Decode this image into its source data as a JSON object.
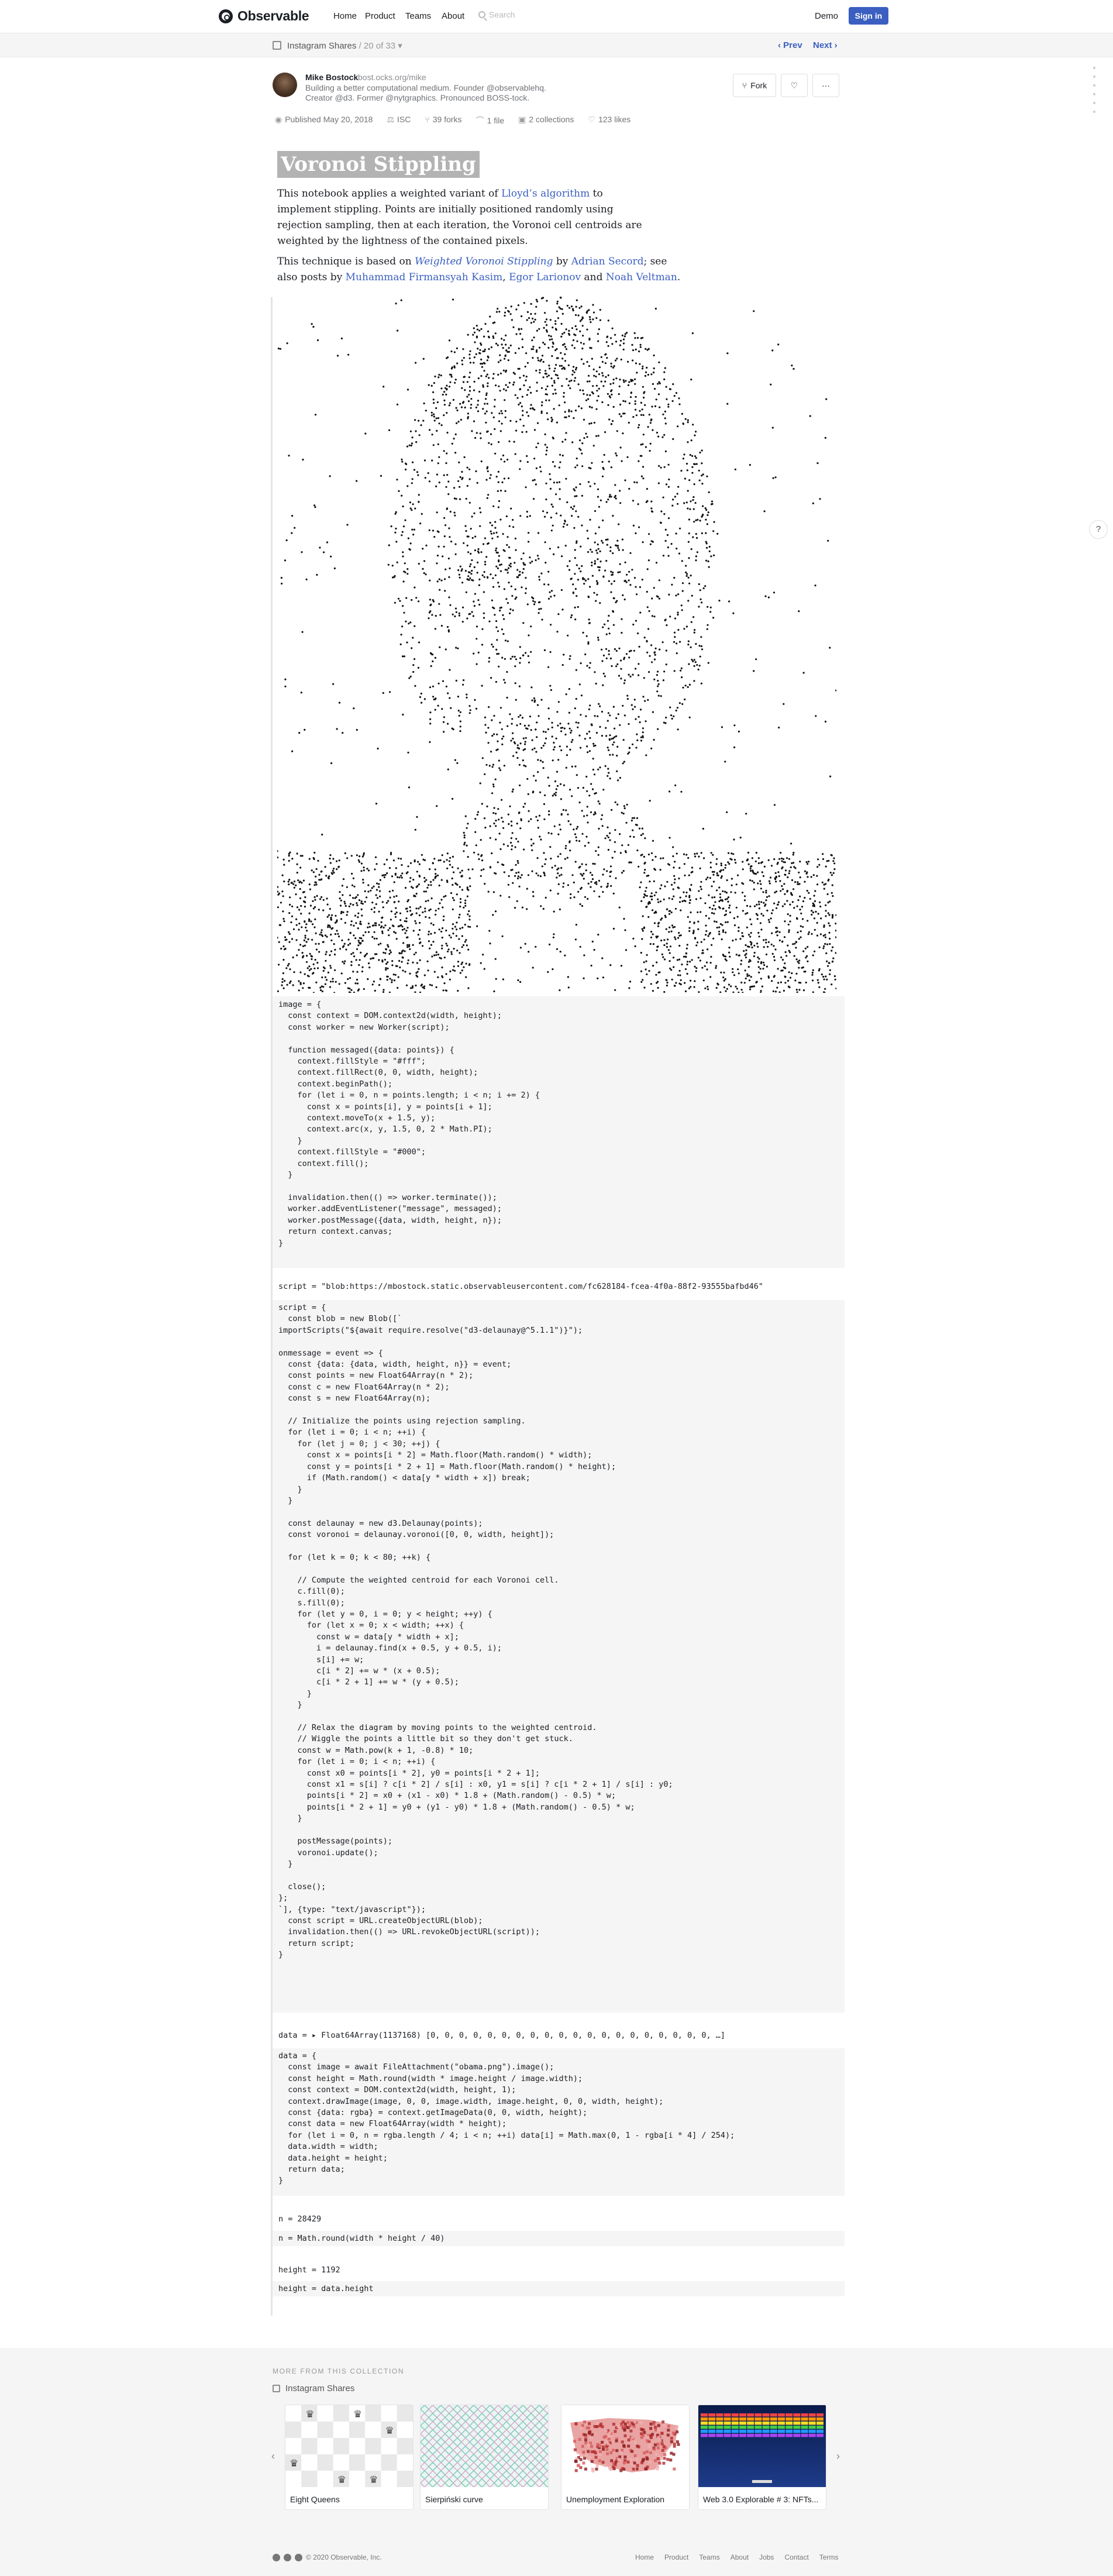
{
  "nav": {
    "brand": "Observable",
    "links": [
      "Home",
      "Product",
      "Teams",
      "About"
    ],
    "search_placeholder": "Search",
    "demo": "Demo",
    "signin": "Sign in"
  },
  "collection": {
    "name": "Instagram Shares",
    "position": "/ 20 of 33",
    "prev": "‹ Prev",
    "next": "Next ›"
  },
  "author": {
    "name": "Mike Bostock",
    "site": "bost.ocks.org/mike",
    "bio1": "Building a better computational medium. Founder @observablehq.",
    "bio2": "Creator @d3. Former @nytgraphics. Pronounced BOSS-tock."
  },
  "actions": {
    "fork": "Fork"
  },
  "meta": {
    "published": "Published May 20, 2018",
    "license": "ISC",
    "forks": "39 forks",
    "files": "1 file",
    "collections": "2 collections",
    "likes": "123 likes"
  },
  "notebook": {
    "title": "Voronoi Stippling",
    "p1_a": "This notebook applies a weighted variant of ",
    "p1_link": "Lloyd’s algorithm",
    "p1_b": " to implement stippling. Points are initially positioned randomly using rejection sampling, then at each iteration, the Voronoi cell centroids are weighted by the lightness of the contained pixels.",
    "p2_a": "This technique is based on ",
    "p2_link1": "Weighted Voronoi Stippling",
    "p2_b": " by ",
    "p2_link2": "Adrian Secord",
    "p2_c": "; see also posts by ",
    "p2_link3": "Muhammad Firmansyah Kasim",
    "p2_d": ", ",
    "p2_link4": "Egor Larionov",
    "p2_e": " and ",
    "p2_link5": "Noah Veltman",
    "p2_f": "."
  },
  "cells": {
    "image_code": "image = {\n  const context = DOM.context2d(width, height);\n  const worker = new Worker(script);\n\n  function messaged({data: points}) {\n    context.fillStyle = \"#fff\";\n    context.fillRect(0, 0, width, height);\n    context.beginPath();\n    for (let i = 0, n = points.length; i < n; i += 2) {\n      const x = points[i], y = points[i + 1];\n      context.moveTo(x + 1.5, y);\n      context.arc(x, y, 1.5, 0, 2 * Math.PI);\n    }\n    context.fillStyle = \"#000\";\n    context.fill();\n  }\n\n  invalidation.then(() => worker.terminate());\n  worker.addEventListener(\"message\", messaged);\n  worker.postMessage({data, width, height, n});\n  return context.canvas;\n}",
    "script_output": "script = \"blob:https://mbostock.static.observableusercontent.com/fc628184-fcea-4f0a-88f2-93555bafbd46\"",
    "script_code": "script = {\n  const blob = new Blob([`\nimportScripts(\"${await require.resolve(\"d3-delaunay@^5.1.1\")}\");\n\nonmessage = event => {\n  const {data: {data, width, height, n}} = event;\n  const points = new Float64Array(n * 2);\n  const c = new Float64Array(n * 2);\n  const s = new Float64Array(n);\n\n  // Initialize the points using rejection sampling.\n  for (let i = 0; i < n; ++i) {\n    for (let j = 0; j < 30; ++j) {\n      const x = points[i * 2] = Math.floor(Math.random() * width);\n      const y = points[i * 2 + 1] = Math.floor(Math.random() * height);\n      if (Math.random() < data[y * width + x]) break;\n    }\n  }\n\n  const delaunay = new d3.Delaunay(points);\n  const voronoi = delaunay.voronoi([0, 0, width, height]);\n\n  for (let k = 0; k < 80; ++k) {\n\n    // Compute the weighted centroid for each Voronoi cell.\n    c.fill(0);\n    s.fill(0);\n    for (let y = 0, i = 0; y < height; ++y) {\n      for (let x = 0; x < width; ++x) {\n        const w = data[y * width + x];\n        i = delaunay.find(x + 0.5, y + 0.5, i);\n        s[i] += w;\n        c[i * 2] += w * (x + 0.5);\n        c[i * 2 + 1] += w * (y + 0.5);\n      }\n    }\n\n    // Relax the diagram by moving points to the weighted centroid.\n    // Wiggle the points a little bit so they don't get stuck.\n    const w = Math.pow(k + 1, -0.8) * 10;\n    for (let i = 0; i < n; ++i) {\n      const x0 = points[i * 2], y0 = points[i * 2 + 1];\n      const x1 = s[i] ? c[i * 2] / s[i] : x0, y1 = s[i] ? c[i * 2 + 1] / s[i] : y0;\n      points[i * 2] = x0 + (x1 - x0) * 1.8 + (Math.random() - 0.5) * w;\n      points[i * 2 + 1] = y0 + (y1 - y0) * 1.8 + (Math.random() - 0.5) * w;\n    }\n\n    postMessage(points);\n    voronoi.update();\n  }\n\n  close();\n};\n`], {type: \"text/javascript\"});\n  const script = URL.createObjectURL(blob);\n  invalidation.then(() => URL.revokeObjectURL(script));\n  return script;\n}",
    "data_output": "data = ▸ Float64Array(1137168) [0, 0, 0, 0, 0, 0, 0, 0, 0, 0, 0, 0, 0, 0, 0, 0, 0, 0, 0, 0, …]",
    "data_code": "data = {\n  const image = await FileAttachment(\"obama.png\").image();\n  const height = Math.round(width * image.height / image.width);\n  const context = DOM.context2d(width, height, 1);\n  context.drawImage(image, 0, 0, image.width, image.height, 0, 0, width, height);\n  const {data: rgba} = context.getImageData(0, 0, width, height);\n  const data = new Float64Array(width * height);\n  for (let i = 0, n = rgba.length / 4; i < n; ++i) data[i] = Math.max(0, 1 - rgba[i * 4] / 254);\n  data.width = width;\n  data.height = height;\n  return data;\n}",
    "n_output": "n = 28429",
    "n_code": "n = Math.round(width * height / 40)",
    "height_output": "height = 1192",
    "height_code": "height = data.height"
  },
  "more": {
    "label": "MORE FROM THIS COLLECTION",
    "collection": "Instagram Shares",
    "cards": [
      "Eight Queens",
      "Sierpiński curve",
      "Unemployment Exploration",
      "Web 3.0 Explorable # 3: NFTs..."
    ]
  },
  "footer": {
    "copyright": "© 2020 Observable, Inc.",
    "links": [
      "Home",
      "Product",
      "Teams",
      "About",
      "Jobs",
      "Contact",
      "Terms"
    ]
  }
}
